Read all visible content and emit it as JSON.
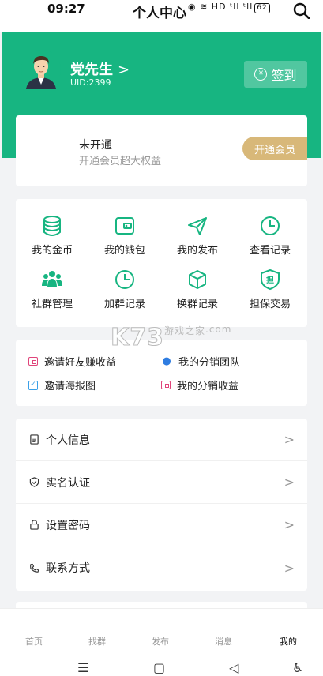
{
  "status_bar": {
    "time": "09:27",
    "title": "个人中心",
    "icons": "◉ ≋ HD ᵗll ᵗll",
    "battery": "62"
  },
  "profile": {
    "name": "党先生",
    "chevron": ">",
    "uid": "UID:2399",
    "signin_label": "签到",
    "coin_glyph": "¥"
  },
  "vip": {
    "status": "未开通",
    "subtitle": "开通会员超大权益",
    "button": "开通会员"
  },
  "grid": {
    "row1": [
      "我的金币",
      "我的钱包",
      "我的发布",
      "查看记录"
    ],
    "row2": [
      "社群管理",
      "加群记录",
      "换群记录",
      "担保交易"
    ],
    "accent": "#17b581",
    "guarantee_glyph": "担"
  },
  "links": {
    "invite_friends": "邀请好友赚收益",
    "my_team": "我的分销团队",
    "invite_poster": "邀请海报图",
    "my_income": "我的分销收益"
  },
  "list": {
    "items": [
      "个人信息",
      "实名认证",
      "设置密码",
      "联系方式"
    ],
    "chevron": ">"
  },
  "tabs": [
    "首页",
    "找群",
    "发布",
    "消息",
    "我的"
  ],
  "nav": {
    "menu": "☰",
    "home": "▢",
    "back": "◁",
    "accessibility": "♿"
  },
  "watermark": {
    "main": "K73",
    "sub": "游戏之家",
    "domain": ".com"
  }
}
